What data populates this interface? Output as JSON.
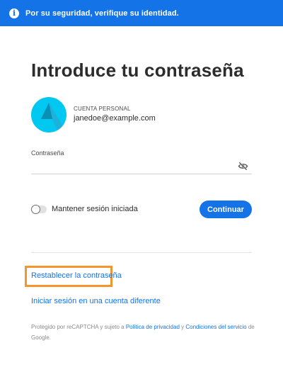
{
  "banner": {
    "icon": "info-icon",
    "text": "Por su seguridad, verifique su identidad."
  },
  "title": "Introduce tu contraseña",
  "account": {
    "avatar_icon": "adobe-logo-icon",
    "type": "CUENTA PERSONAL",
    "email": "janedoe@example.com"
  },
  "password": {
    "label": "Contraseña",
    "value": "",
    "toggle_icon": "eye-slash-icon"
  },
  "stay_signed_in": {
    "label": "Mantener sesión iniciada",
    "checked": false
  },
  "continue_label": "Continuar",
  "links": {
    "reset": "Restablecer la contraseña",
    "other_account": "Iniciar sesión en una cuenta diferente"
  },
  "legal": {
    "prefix": "Protegido por reCAPTCHA y sujeto a ",
    "privacy": "Política de privacidad",
    "and": " y ",
    "terms": "Condiciones del servicio",
    "suffix": " de Google."
  },
  "colors": {
    "accent": "#1473e6",
    "highlight": "#f2962d",
    "avatar": "#00c8f0"
  }
}
